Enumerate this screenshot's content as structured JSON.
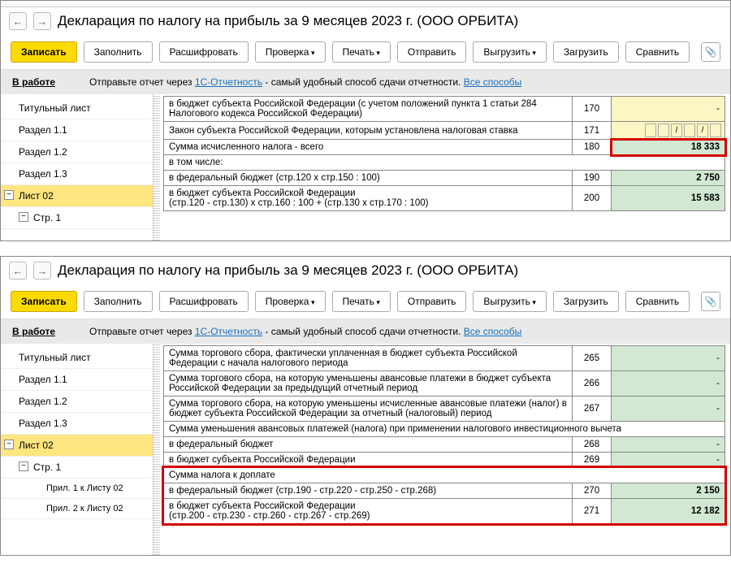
{
  "title": "Декларация по налогу на прибыль за 9 месяцев 2023 г. (ООО ОРБИТА)",
  "toolbar": {
    "save": "Записать",
    "fill": "Заполнить",
    "decrypt": "Расшифровать",
    "check": "Проверка",
    "print": "Печать",
    "send": "Отправить",
    "upload": "Выгрузить",
    "load": "Загрузить",
    "compare": "Сравнить"
  },
  "info": {
    "status": "В работе",
    "text1": "Отправьте отчет через ",
    "link1": "1С-Отчетность",
    "text2": " - самый удобный способ сдачи отчетности. ",
    "link2": "Все способы"
  },
  "side1": {
    "i0": "Титульный лист",
    "i1": "Раздел 1.1",
    "i2": "Раздел 1.2",
    "i3": "Раздел 1.3",
    "i4": "Лист 02",
    "i5": "Стр. 1"
  },
  "side2": {
    "i0": "Титульный лист",
    "i1": "Раздел 1.1",
    "i2": "Раздел 1.2",
    "i3": "Раздел 1.3",
    "i4": "Лист 02",
    "i5": "Стр. 1",
    "i6": "Прил. 1 к Листу 02",
    "i7": "Прил. 2 к Листу 02"
  },
  "pane1": {
    "r170_label": "в бюджет субъекта Российской Федерации (с учетом положений пункта 1 статьи 284 Налогового кодекса Российской Федерации)",
    "r170_code": "170",
    "r170_val": "-",
    "r171_label": "Закон субъекта Российской Федерации, которым установлена налоговая ставка",
    "r171_code": "171",
    "r180_label": "Сумма исчисленного налога - всего",
    "r180_code": "180",
    "r180_val": "18 333",
    "r_sub": "в том числе:",
    "r190_label": "в федеральный бюджет (стр.120 х стр.150 : 100)",
    "r190_code": "190",
    "r190_val": "2 750",
    "r200_label": "в бюджет субъекта Российской Федерации\n(стр.120 - стр.130) х стр.160 : 100 + (стр.130 х стр.170 : 100)",
    "r200_code": "200",
    "r200_val": "15 583"
  },
  "pane2": {
    "r265_label": "Сумма торгового сбора, фактически уплаченная в бюджет субъекта Российской Федерации с начала налогового периода",
    "r265_code": "265",
    "r265_val": "-",
    "r266_label": "Сумма торгового сбора, на которую уменьшены авансовые платежи в бюджет субъекта Российской Федерации за предыдущий отчетный период",
    "r266_code": "266",
    "r266_val": "-",
    "r267_label": "Сумма торгового сбора, на которую уменьшены исчисленные авансовые платежи (налог) в бюджет субъекта Российской Федерации за отчетный (налоговый) период",
    "r267_code": "267",
    "r267_val": "-",
    "r_inv": "Сумма уменьшения авансовых платежей (налога) при применении налогового инвестиционного вычета",
    "r268_label": "в федеральный бюджет",
    "r268_code": "268",
    "r268_val": "-",
    "r269_label": "в бюджет субъекта Российской Федерации",
    "r269_code": "269",
    "r269_val": "-",
    "r_pay": "Сумма налога к доплате",
    "r270_label": "в федеральный бюджет (стр.190 - стр.220 - стр.250 - стр.268)",
    "r270_code": "270",
    "r270_val": "2 150",
    "r271_label": "в бюджет субъекта Российской Федерации\n(стр.200 - стр.230 - стр.260 - стр.267 - стр.269)",
    "r271_code": "271",
    "r271_val": "12 182"
  }
}
